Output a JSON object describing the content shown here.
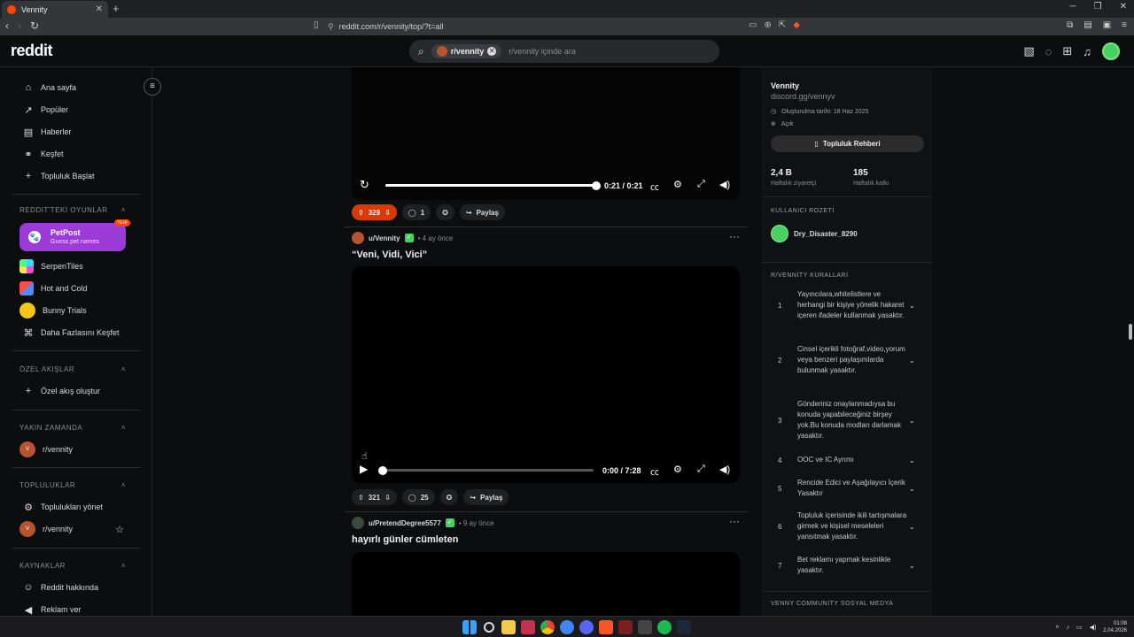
{
  "browser": {
    "tab_title": "Vennity",
    "url": "reddit.com/r/vennity/top/?t=all"
  },
  "header": {
    "logo": "reddit",
    "search_chip": "r/vennity",
    "search_placeholder": "r/vennity içinde ara"
  },
  "sidebar": {
    "nav": [
      {
        "label": "Ana sayfa",
        "icon": "home-icon"
      },
      {
        "label": "Popüler",
        "icon": "trending-icon"
      },
      {
        "label": "Haberler",
        "icon": "news-icon"
      },
      {
        "label": "Keşfet",
        "icon": "explore-icon"
      },
      {
        "label": "Topluluk Başlat",
        "icon": "plus-icon"
      }
    ],
    "games_title": "REDDIT'TEKİ OYUNLAR",
    "petpost": {
      "title": "PetPost",
      "subtitle": "Guess pet names",
      "badge": "YENİ"
    },
    "games": [
      {
        "label": "SerpenTiles"
      },
      {
        "label": "Hot and Cold"
      },
      {
        "label": "Bunny Trials"
      },
      {
        "label": "Daha Fazlasını Keşfet"
      }
    ],
    "custom_title": "ÖZEL AKIŞLAR",
    "custom_create": "Özel akış oluştur",
    "recent_title": "YAKIN ZAMANDA",
    "recent_item": "r/vennity",
    "communities_title": "TOPLULUKLAR",
    "manage": "Toplulukları yönet",
    "community_item": "r/vennity",
    "resources_title": "KAYNAKLAR",
    "about": "Reddit hakkında",
    "ads": "Reklam ver"
  },
  "feed": {
    "post1": {
      "time": "0:21 / 0:21",
      "progress": 1.0,
      "votes": "329",
      "comments": "1",
      "share": "Paylaş"
    },
    "post2": {
      "user": "u/Vennity",
      "age": "• 4 ay önce",
      "title": "“Veni, Vidi, Vici”",
      "time": "0:00 / 7:28",
      "progress": 0.0,
      "votes": "321",
      "comments": "25",
      "share": "Paylaş"
    },
    "post3": {
      "user": "u/PretendDegree5577",
      "age": "• 9 ay önce",
      "title": "hayırlı günler cümleten"
    }
  },
  "community": {
    "name": "Vennity",
    "link": "discord.gg/vennyv",
    "created": "Oluşturulma tarihi: 18 Haz 2025",
    "visibility": "Açık",
    "guide_button": "Topluluk Rehberi",
    "visitors_value": "2,4 B",
    "visitors_label": "Haftalık ziyaretçi",
    "contrib_value": "185",
    "contrib_label": "Haftalık katkı",
    "user_flair_title": "KULLANICI ROZETİ",
    "user_flair_name": "Dry_Disaster_8290",
    "rules_title": "R/VENNİTY KURALLARI",
    "rules": [
      {
        "num": "1",
        "text": "Yayıncılara,whitelistlere ve herhangi bir kişiye yönelik hakaret içeren ifadeler kullanmak yasaktır."
      },
      {
        "num": "2",
        "text": "Cinsel içerikli fotoğraf,video,yorum veya benzeri paylaşımlarda bulunmak yasaktır."
      },
      {
        "num": "3",
        "text": "Gönderiniz onaylanmadıysa bu konuda yapabileceğiniz birşey yok.Bu konuda modları darlamak yasaktır."
      },
      {
        "num": "4",
        "text": "OOC ve IC Ayrımı"
      },
      {
        "num": "5",
        "text": "Rencide Edici ve Aşağılayıcı İçerik Yasaktır"
      },
      {
        "num": "6",
        "text": "Topluluk içerisinde ikili tartışmalara girmek ve kişisel meseleleri yansıtmak yasaktır."
      },
      {
        "num": "7",
        "text": "Bet reklamı yapmak kesinlikle yasaktır."
      }
    ],
    "social_title": "VENNY COMMUNİTY SOSYAL MEDYA"
  },
  "taskbar": {
    "time": "01:08",
    "date": "2.04.2026"
  },
  "colors": {
    "upvote_active": "#d93a00",
    "accent": "#ff4500",
    "petpost": "#9c3bd8",
    "online": "#46d160"
  }
}
